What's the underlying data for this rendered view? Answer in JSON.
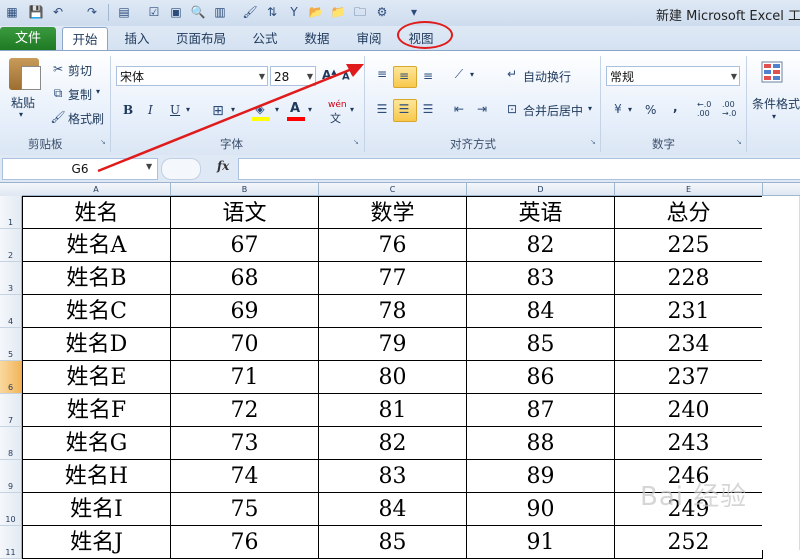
{
  "window": {
    "title": "新建 Microsoft Excel 工作"
  },
  "tabs": [
    {
      "label": "文件"
    },
    {
      "label": "开始"
    },
    {
      "label": "插入"
    },
    {
      "label": "页面布局"
    },
    {
      "label": "公式"
    },
    {
      "label": "数据"
    },
    {
      "label": "审阅"
    },
    {
      "label": "视图"
    }
  ],
  "clipboard": {
    "paste": "粘贴",
    "cut": "剪切",
    "copy": "复制",
    "format_painter": "格式刷",
    "group": "剪贴板"
  },
  "font": {
    "name": "宋体",
    "size": "28",
    "bold": "B",
    "italic": "I",
    "underline": "U",
    "group": "字体",
    "phonetic": "wén"
  },
  "alignment": {
    "wrap": "自动换行",
    "merge": "合并后居中",
    "group": "对齐方式"
  },
  "number": {
    "format": "常规",
    "percent": "%",
    "comma": ",",
    "group": "数字"
  },
  "styles": {
    "conditional": "条件格式"
  },
  "formula_bar": {
    "name_box": "G6",
    "fx": "fx",
    "value": ""
  },
  "columns": [
    "A",
    "B",
    "C",
    "D",
    "E"
  ],
  "rows": [
    "1",
    "2",
    "3",
    "4",
    "5",
    "6",
    "7",
    "8",
    "9",
    "10",
    "11"
  ],
  "selected_row": "6",
  "table": [
    [
      "姓名",
      "语文",
      "数学",
      "英语",
      "总分"
    ],
    [
      "姓名A",
      "67",
      "76",
      "82",
      "225"
    ],
    [
      "姓名B",
      "68",
      "77",
      "83",
      "228"
    ],
    [
      "姓名C",
      "69",
      "78",
      "84",
      "231"
    ],
    [
      "姓名D",
      "70",
      "79",
      "85",
      "234"
    ],
    [
      "姓名E",
      "71",
      "80",
      "86",
      "237"
    ],
    [
      "姓名F",
      "72",
      "81",
      "87",
      "240"
    ],
    [
      "姓名G",
      "73",
      "82",
      "88",
      "243"
    ],
    [
      "姓名H",
      "74",
      "83",
      "89",
      "246"
    ],
    [
      "姓名I",
      "75",
      "84",
      "90",
      "249"
    ],
    [
      "姓名J",
      "76",
      "85",
      "91",
      "252"
    ]
  ],
  "watermark": "Bai 经验",
  "colors": {
    "file_tab": "#2a8a2f",
    "annotation": "#e01b1b",
    "selection": "#f2b55a"
  }
}
